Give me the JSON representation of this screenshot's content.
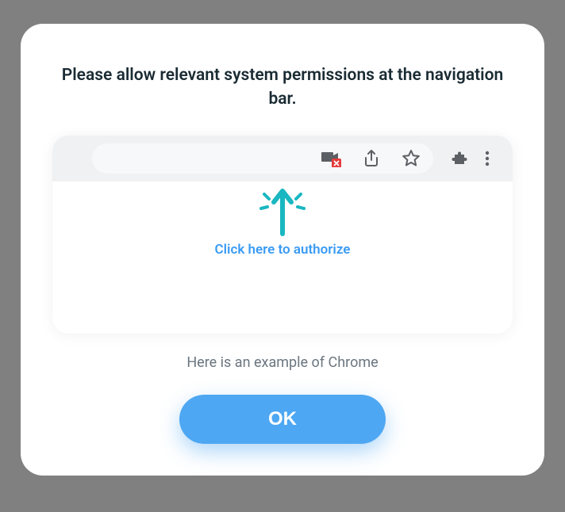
{
  "modal": {
    "title": "Please allow relevant system permissions at the navigation bar.",
    "hint": "Click here to authorize",
    "caption": "Here is an example of Chrome",
    "ok_label": "OK"
  },
  "icons": {
    "camera_blocked": "camera-blocked-icon",
    "share": "share-icon",
    "star": "star-icon",
    "extensions": "puzzle-icon",
    "more": "more-vertical-icon"
  },
  "colors": {
    "accent": "#4ea7f2",
    "hint": "#3a9bf4",
    "arrow": "#19b7c1",
    "icon_gray": "#5c6064",
    "blocked_red": "#e53b3b",
    "text_dark": "#1a2b33",
    "text_muted": "#6b7680"
  }
}
